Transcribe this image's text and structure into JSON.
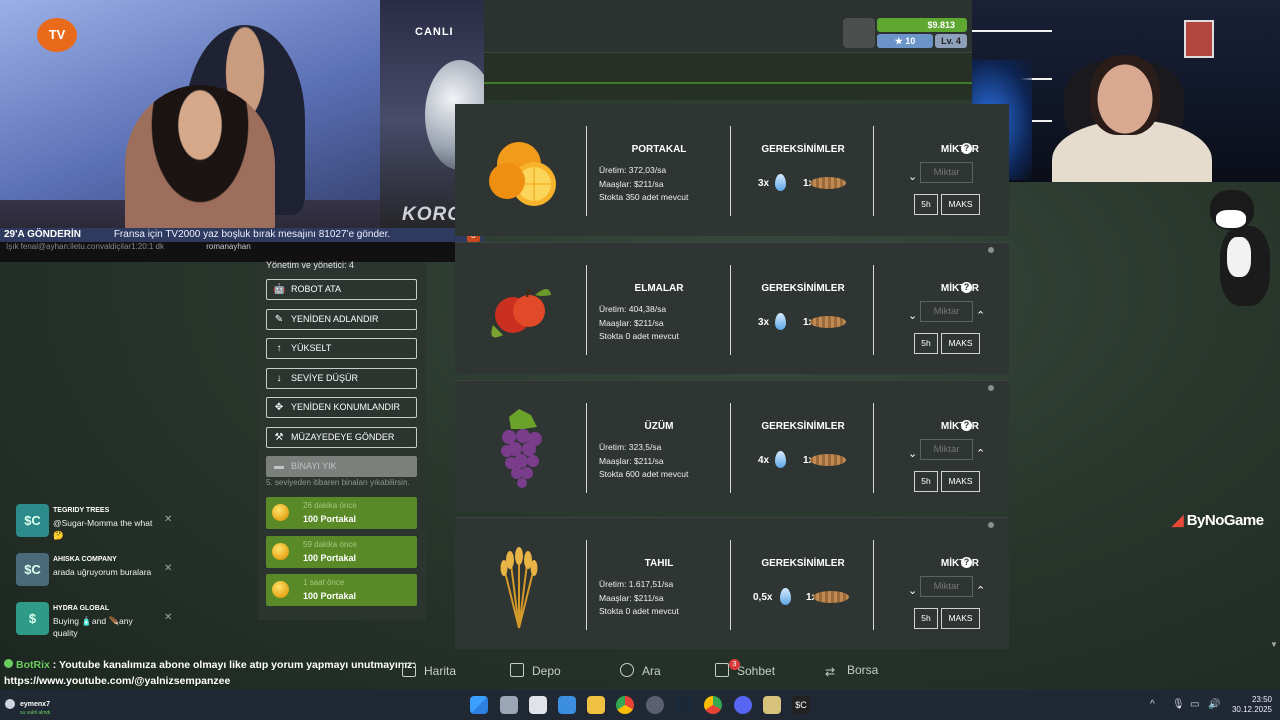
{
  "video": {
    "channel_logo": "TV",
    "live_label": "CANLI",
    "brand": "KORG",
    "ticker_main": "29'A GÖNDERİN",
    "ticker_text": "Fransa için TV2000 yaz boşluk bırak mesajını 81027'e gönder.",
    "ticker_small": "Işık fenal@ayhan:iletu.convaldiçilar1:20:1 dk",
    "ticker_site": "romanayhan"
  },
  "hud": {
    "money": "$9.813",
    "stars": "10",
    "level": "Lv. 4"
  },
  "menu": {
    "title": "Yönetim ve yönetici: 4",
    "buttons": [
      {
        "label": "ROBOT ATA",
        "icon": "robot-icon"
      },
      {
        "label": "YENİDEN ADLANDIR",
        "icon": "edit-icon"
      },
      {
        "label": "YÜKSELT",
        "icon": "arrow-up-icon"
      },
      {
        "label": "SEVİYE DÜŞÜR",
        "icon": "arrow-down-icon"
      },
      {
        "label": "YENİDEN KONUMLANDIR",
        "icon": "move-icon"
      },
      {
        "label": "MÜZAYEDEYE GÖNDER",
        "icon": "gavel-icon"
      },
      {
        "label": "BİNAYI YIK",
        "icon": "demolish-icon"
      }
    ],
    "note": "5. seviyeden itibaren binaları yıkabilirsin.",
    "notifications": [
      {
        "time": "26 dakika önce",
        "value": "100 Portakal"
      },
      {
        "time": "59 dakika önce",
        "value": "100 Portakal"
      },
      {
        "time": "1 saat önce",
        "value": "100 Portakal"
      }
    ]
  },
  "products": [
    {
      "name": "PORTAKAL",
      "production": "Üretim: 372,03/sa",
      "wages": "Maaşlar: $211/sa",
      "stock": "Stokta 350 adet mevcut",
      "water": "3x",
      "seed": "1x",
      "icon": "orange-icon"
    },
    {
      "name": "ELMALAR",
      "production": "Üretim: 404,38/sa",
      "wages": "Maaşlar: $211/sa",
      "stock": "Stokta 0 adet mevcut",
      "water": "3x",
      "seed": "1x",
      "icon": "apple-icon"
    },
    {
      "name": "ÜZÜM",
      "production": "Üretim: 323,5/sa",
      "wages": "Maaşlar: $211/sa",
      "stock": "Stokta 600 adet mevcut",
      "water": "4x",
      "seed": "1x",
      "icon": "grape-icon"
    },
    {
      "name": "TAHIL",
      "production": "Üretim: 1.617,51/sa",
      "wages": "Maaşlar: $211/sa",
      "stock": "Stokta 0 adet mevcut",
      "water": "0,5x",
      "seed": "1x",
      "icon": "wheat-icon"
    }
  ],
  "card_labels": {
    "requirements": "GEREKSİNİMLER",
    "amount": "MİKTAR",
    "amount_placeholder": "Miktar",
    "btn_5h": "5h",
    "btn_max": "MAKS"
  },
  "chat": [
    {
      "name": "TEGRIDY TREES",
      "message": "@Sugar-Momma the what 🤔",
      "avatar": "$C"
    },
    {
      "name": "AHISKA COMPANY",
      "message": "arada uğruyorum buralara",
      "avatar": "$C"
    },
    {
      "name": "HYDRA GLOBAL",
      "message": "Buying 🧴and 🪶any quality",
      "avatar": "$"
    }
  ],
  "sponsor": "ByNoGame",
  "botrix": {
    "name": "BotRix",
    "message": ": Youtube kanalımıza abone olmayı like atıp yorum yapmayı unutmayınız:",
    "link": "https://www.youtube.com/@yalnizsempanzee"
  },
  "game_nav": [
    {
      "label": "Harita",
      "icon": "map-icon"
    },
    {
      "label": "Depo",
      "icon": "warehouse-icon"
    },
    {
      "label": "Ara",
      "icon": "search-icon"
    },
    {
      "label": "Sohbet",
      "icon": "chat-icon",
      "badge": "3"
    },
    {
      "label": "Borsa",
      "icon": "exchange-icon"
    }
  ],
  "taskbar": {
    "user": "eymenx7",
    "user_status": "su vakti almdı",
    "time": "23:50",
    "date": "30.12.2025"
  },
  "colors": {
    "accent_green": "#5ea832",
    "notification_green": "#5a8a28",
    "card_bg": "#2f3532"
  }
}
